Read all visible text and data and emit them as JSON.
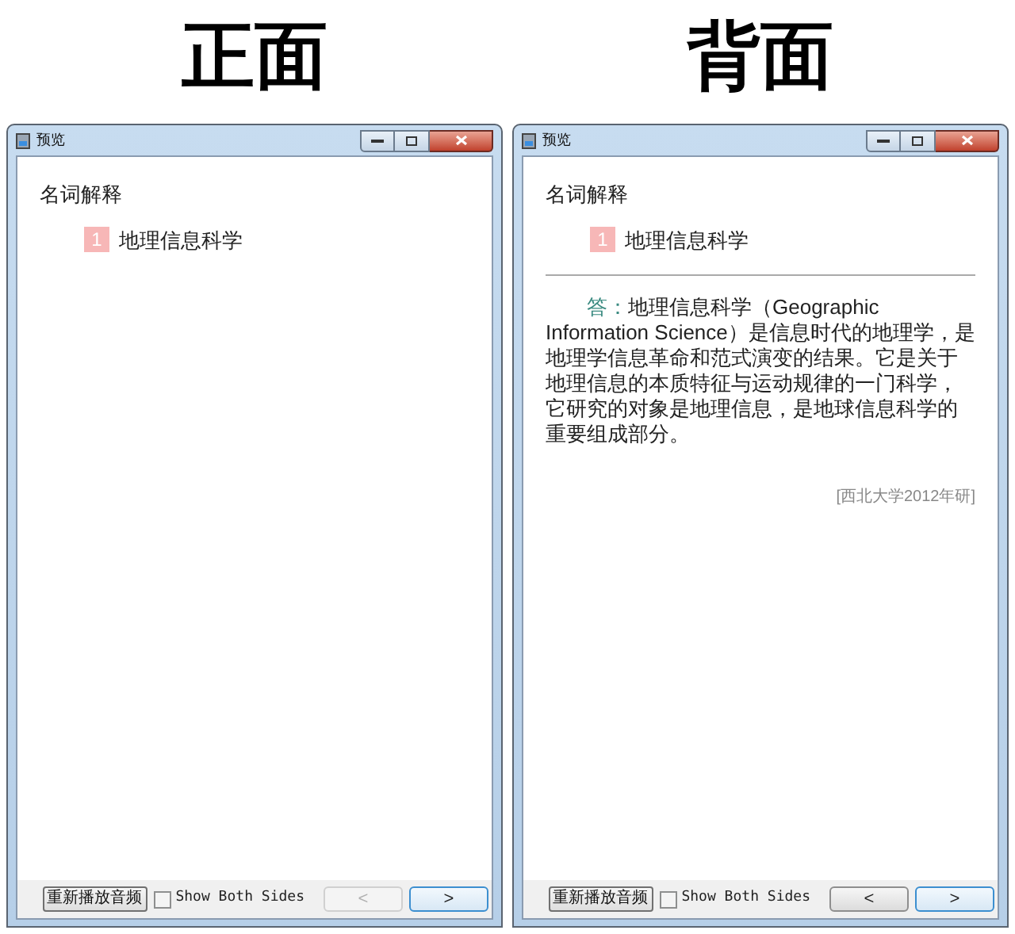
{
  "panels": [
    {
      "heading": "正面",
      "window": {
        "title": "预览"
      },
      "card": {
        "category": "名词解释",
        "number": "1",
        "term": "地理信息科学"
      },
      "footer": {
        "replay_button": "重新播放音频",
        "show_both_sides": {
          "label": "Show Both Sides",
          "checked": false
        },
        "prev_button": {
          "label": "<",
          "disabled": true
        },
        "next_button": {
          "label": ">",
          "disabled": false
        }
      }
    },
    {
      "heading": "背面",
      "window": {
        "title": "预览"
      },
      "card": {
        "category": "名词解释",
        "number": "1",
        "term": "地理信息科学",
        "answer_label": "答：",
        "answer_text": "地理信息科学（Geographic Information Science）是信息时代的地理学，是地理学信息革命和范式演变的结果。它是关于地理信息的本质特征与运动规律的一门科学，它研究的对象是地理信息，是地球信息科学的重要组成部分。",
        "source": "[西北大学2012年研]"
      },
      "footer": {
        "replay_button": "重新播放音频",
        "show_both_sides": {
          "label": "Show Both Sides",
          "checked": false
        },
        "prev_button": {
          "label": "<",
          "disabled": false
        },
        "next_button": {
          "label": ">",
          "disabled": false
        }
      }
    }
  ]
}
